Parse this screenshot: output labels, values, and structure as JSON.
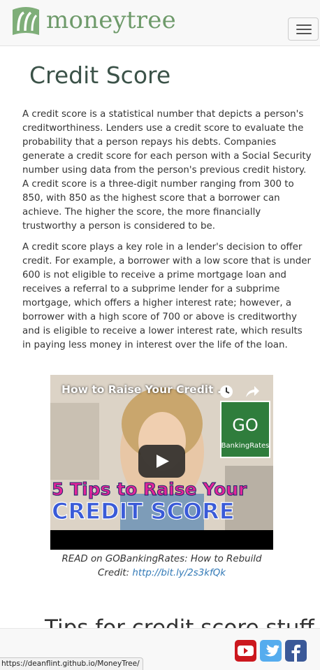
{
  "header": {
    "brand_name": "moneytree",
    "brand_color": "#6e9a6a",
    "logo_icon": "money-tree-logo",
    "menu_icon": "hamburger-menu-icon"
  },
  "page": {
    "title": "Credit Score",
    "paragraphs": [
      "A credit score is a statistical number that depicts a person's creditworthiness. Lenders use a credit score to evaluate the probability that a person repays his debts. Companies generate a credit score for each person with a Social Security number using data from the person's previous credit history. A credit score is a three-digit number ranging from 300 to 850, with 850 as the highest score that a borrower can achieve. The higher the score, the more financially trustworthy a person is considered to be.",
      "A credit score plays a key role in a lender's decision to offer credit. For example, a borrower with a low score that is under 600 is not eligible to receive a prime mortgage loan and receives a referral to a subprime lender for a subprime mortgage, which offers a higher interest rate; however, a borrower with a high score of 700 or above is creditworthy and is eligible to receive a lower interest rate, which results in paying less money in interest over the life of the loan."
    ],
    "video": {
      "title": "How to Raise Your Credit ...",
      "thumbnail_text_line1": "5 Tips to Raise Your",
      "thumbnail_text_line2": "CREDIT SCORE",
      "badge_main": "GO",
      "badge_sub": "BankingRates"
    },
    "caption": {
      "text": "READ on GOBankingRates: How to Rebuild Credit: ",
      "link": "http://bit.ly/2s3kfQk"
    },
    "section_heading": "Tips for credit score stuff"
  },
  "footer": {
    "social_icons": [
      "youtube-icon",
      "twitter-icon",
      "facebook-icon"
    ],
    "colors": {
      "youtube": "#cc181e",
      "twitter": "#55acee",
      "facebook": "#3b5998"
    }
  },
  "status_bar": {
    "url": "https://deanflint.github.io/MoneyTree/"
  }
}
